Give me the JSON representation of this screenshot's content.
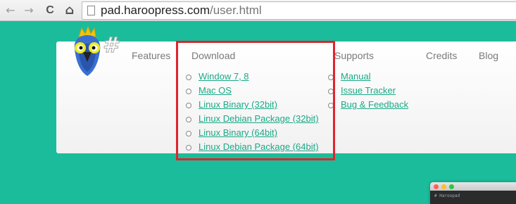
{
  "browser": {
    "back_icon": "←",
    "forward_icon": "→",
    "reload_icon": "C",
    "home_icon": "⌂",
    "url_host": "pad.haroopress.com",
    "url_path": "/user.html"
  },
  "site": {
    "logo_hash": "#",
    "nav": {
      "features": "Features",
      "download": "Download",
      "supports": "Supports",
      "credits": "Credits",
      "blog": "Blog"
    },
    "download_menu": [
      "Window 7, 8",
      "Mac OS",
      "Linux Binary (32bit)",
      "Linux Debian Package (32bit)",
      "Linux Binary (64bit)",
      "Linux Debian Package (64bit)"
    ],
    "supports_menu": [
      "Manual",
      "Issue Tracker",
      "Bug & Feedback"
    ]
  },
  "preview": {
    "title": "# Haroopad"
  },
  "colors": {
    "page_bg": "#1bbc9b",
    "link": "#1aa987",
    "highlight": "#e0242b"
  }
}
